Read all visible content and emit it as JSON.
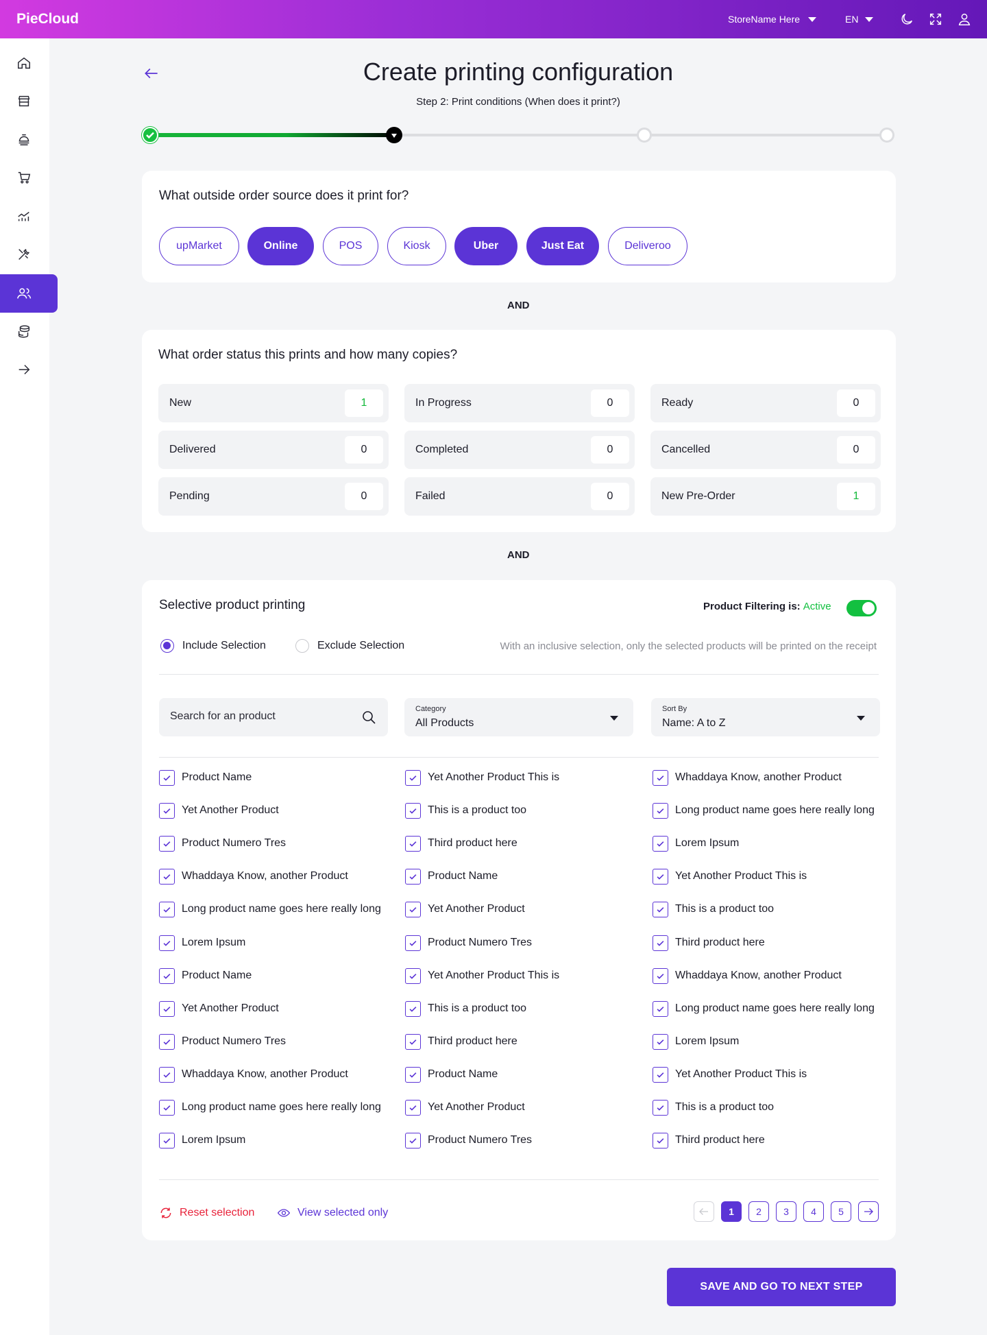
{
  "app": {
    "brand": "PieCloud",
    "store": "StoreName Here",
    "language": "EN"
  },
  "page": {
    "title": "Create printing configuration",
    "step_text": "Step 2:  Print conditions (When does it print?)",
    "steps_total": 4,
    "current_step": 2
  },
  "source": {
    "question": "What outside order source does it print for?",
    "options": [
      {
        "label": "upMarket",
        "selected": false
      },
      {
        "label": "Online",
        "selected": true
      },
      {
        "label": "POS",
        "selected": false
      },
      {
        "label": "Kiosk",
        "selected": false
      },
      {
        "label": "Uber",
        "selected": true
      },
      {
        "label": "Just Eat",
        "selected": true
      },
      {
        "label": "Deliveroo",
        "selected": false
      }
    ]
  },
  "and_label": "AND",
  "status": {
    "question": "What order status this prints and how many copies?",
    "items": [
      {
        "label": "New",
        "value": "1"
      },
      {
        "label": "In Progress",
        "value": "0"
      },
      {
        "label": "Ready",
        "value": "0"
      },
      {
        "label": "Delivered",
        "value": "0"
      },
      {
        "label": "Completed",
        "value": "0"
      },
      {
        "label": "Cancelled",
        "value": "0"
      },
      {
        "label": "Pending",
        "value": "0"
      },
      {
        "label": "Failed",
        "value": "0"
      },
      {
        "label": "New Pre-Order",
        "value": "1"
      }
    ]
  },
  "selective": {
    "title": "Selective product printing",
    "filter_label": "Product Filtering is:",
    "filter_state": "Active",
    "include_label": "Include Selection",
    "exclude_label": "Exclude Selection",
    "hint": "With an inclusive selection, only the selected products will be printed on the receipt",
    "search_placeholder": "Search for an product",
    "category_label": "Category",
    "category_value": "All Products",
    "sort_label": "Sort By",
    "sort_value": "Name: A to Z",
    "columns": [
      [
        "Product Name",
        "Yet Another Product",
        "Product Numero Tres",
        "Whaddaya Know, another Product",
        "Long product name goes here really long",
        "Lorem Ipsum",
        "Product Name",
        "Yet Another Product",
        "Product Numero Tres",
        "Whaddaya Know, another Product",
        "Long product name goes here really long",
        "Lorem Ipsum"
      ],
      [
        "Yet Another Product This is",
        "This is a product too",
        "Third product here",
        "Product Name",
        "Yet Another Product",
        "Product Numero Tres",
        "Yet Another Product This is",
        "This is a product too",
        "Third product here",
        "Product Name",
        "Yet Another Product",
        "Product Numero Tres"
      ],
      [
        "Whaddaya Know, another Product",
        "Long product name goes here really long",
        "Lorem Ipsum",
        "Yet Another Product This is",
        "This is a product too",
        "Third product here",
        "Whaddaya Know, another Product",
        "Long product name goes here really long",
        "Lorem Ipsum",
        "Yet Another Product This is",
        "This is a product too",
        "Third product here"
      ]
    ],
    "reset_label": "Reset selection",
    "view_selected_label": "View selected only",
    "pages": [
      "1",
      "2",
      "3",
      "4",
      "5"
    ],
    "current_page": "1"
  },
  "save_label": "SAVE AND GO TO NEXT STEP",
  "colors": {
    "accent": "#5b34d6",
    "success": "#13c040",
    "danger": "#e8223a"
  }
}
